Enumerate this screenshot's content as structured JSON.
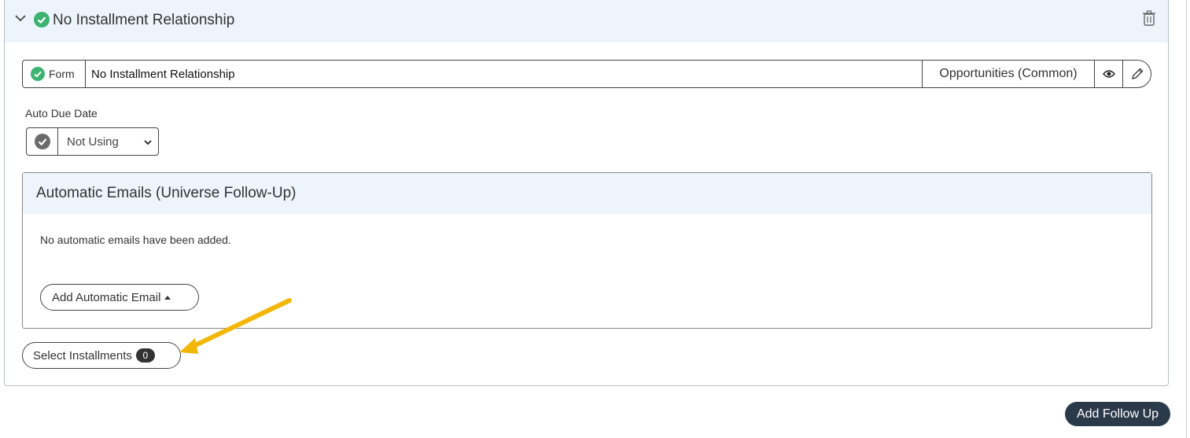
{
  "panel": {
    "title": "No Installment Relationship",
    "form": {
      "tag_label": "Form",
      "name": "No Installment Relationship",
      "category": "Opportunities (Common)"
    },
    "auto_due_date": {
      "label": "Auto Due Date",
      "value": "Not Using",
      "options": [
        "Not Using"
      ]
    },
    "automatic_emails": {
      "title": "Automatic Emails (Universe Follow-Up)",
      "empty_text": "No automatic emails have been added.",
      "add_button_label": "Add Automatic Email"
    },
    "select_installments": {
      "label": "Select Installments",
      "count": "0"
    }
  },
  "add_follow_up_label": "Add Follow Up",
  "colors": {
    "success_green": "#3cb371",
    "header_bg": "#eef4fc",
    "dark_button": "#2b3a4a",
    "annotation_arrow": "#f2b705"
  },
  "icons": [
    "chevron-down-icon",
    "check-circle-icon",
    "trash-icon",
    "eye-icon",
    "pencil-icon",
    "caret-down-icon",
    "caret-up-icon"
  ]
}
